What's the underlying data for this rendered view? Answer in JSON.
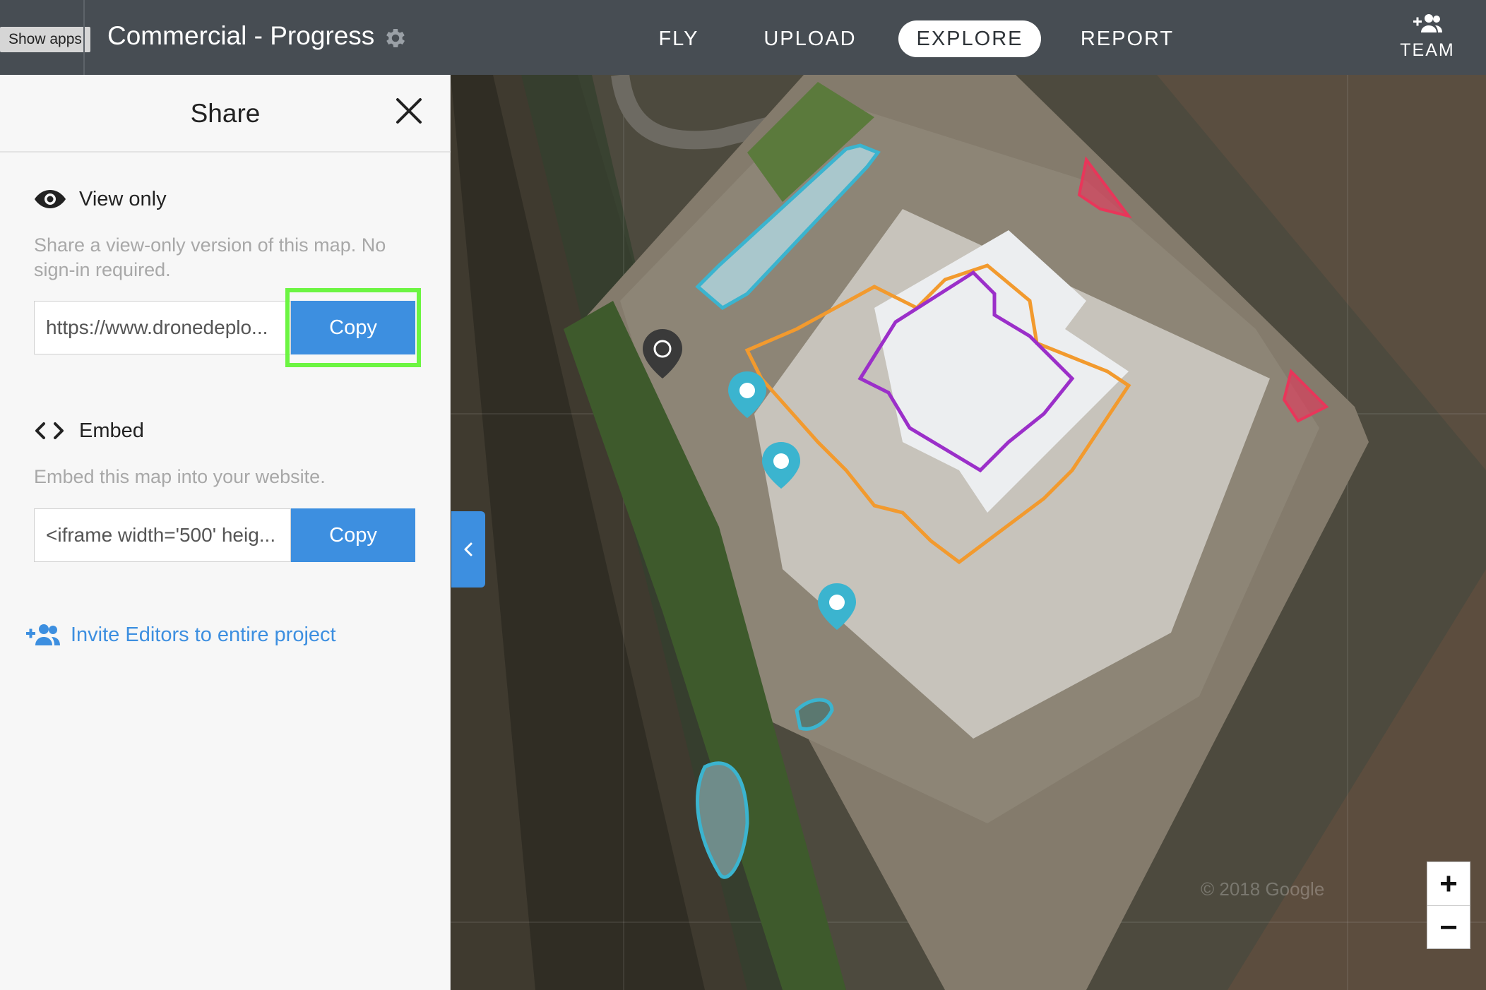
{
  "topbar": {
    "apps_button": "Show apps",
    "project_title": "Commercial - Progress",
    "nav": {
      "fly": "FLY",
      "upload": "UPLOAD",
      "explore": "EXPLORE",
      "report": "REPORT",
      "active": "EXPLORE"
    },
    "team_label": "TEAM"
  },
  "share_panel": {
    "title": "Share",
    "view_only": {
      "heading": "View only",
      "description": "Share a view-only version of this map. No sign-in required.",
      "link_value": "https://www.dronedeplo...",
      "copy_label": "Copy"
    },
    "embed": {
      "heading": "Embed",
      "description": "Embed this map into your website.",
      "code_value": "<iframe width='500' heig...",
      "copy_label": "Copy"
    },
    "invite_label": "Invite Editors to entire project"
  },
  "map": {
    "zoom_in": "+",
    "zoom_out": "−",
    "attribution": "© 2018 Google"
  },
  "colors": {
    "accent_blue": "#3d8fe0",
    "highlight_green": "#6cf542",
    "topbar": "#474d53",
    "annotation_orange": "#f29a2e",
    "annotation_purple": "#9b2fc9",
    "annotation_cyan": "#3bb4cf",
    "annotation_red": "#e8365a"
  }
}
